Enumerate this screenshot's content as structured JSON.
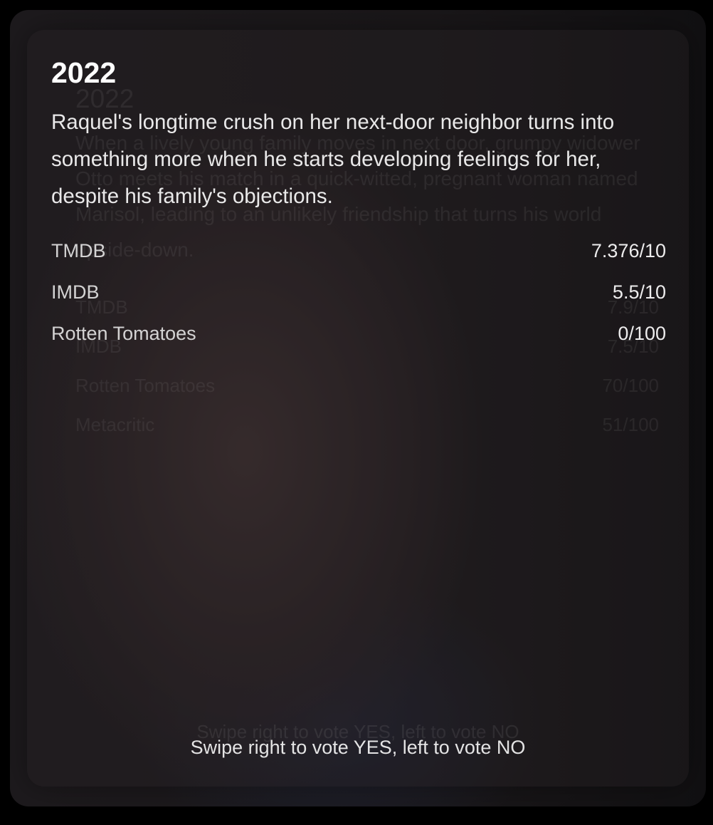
{
  "back_card": {
    "year": "2022",
    "overview": "When a lively young family moves in next door, grumpy widower Otto meets his match in a quick-witted, pregnant woman named Marisol, leading to an unlikely friendship that turns his world upside-down.",
    "ratings": [
      {
        "label": "TMDB",
        "value": "7.9/10"
      },
      {
        "label": "IMDB",
        "value": "7.5/10"
      },
      {
        "label": "Rotten Tomatoes",
        "value": "70/100"
      },
      {
        "label": "Metacritic",
        "value": "51/100"
      }
    ],
    "hint": "Swipe right to vote YES, left to vote NO"
  },
  "front_card": {
    "year": "2022",
    "overview": "Raquel's longtime crush on her next-door neighbor turns into something more when he starts developing feelings for her, despite his family's objections.",
    "ratings": [
      {
        "label": "TMDB",
        "value": "7.376/10"
      },
      {
        "label": "IMDB",
        "value": "5.5/10"
      },
      {
        "label": "Rotten Tomatoes",
        "value": "0/100"
      }
    ],
    "hint": "Swipe right to vote YES, left to vote NO"
  }
}
